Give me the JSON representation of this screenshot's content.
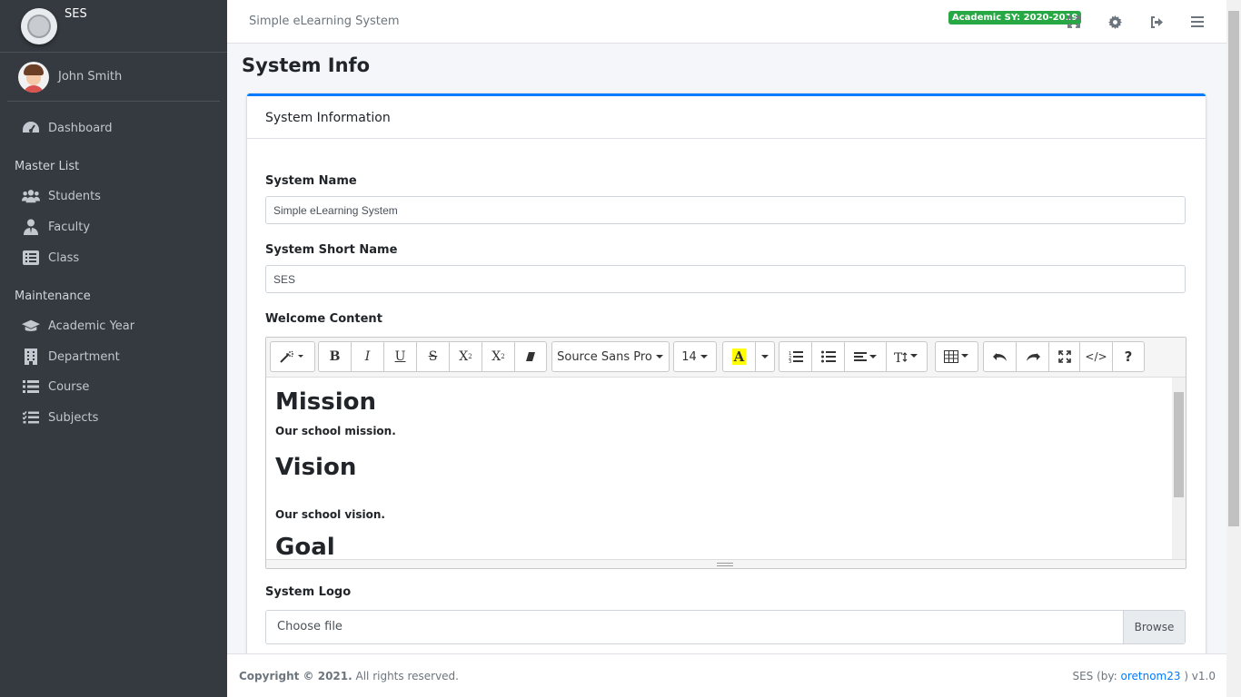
{
  "brand": {
    "name": "SES"
  },
  "user": {
    "name": "John Smith"
  },
  "sidebar": {
    "dashboard": "Dashboard",
    "master_header": "Master List",
    "master_items": [
      {
        "label": "Students",
        "icon": "users-icon"
      },
      {
        "label": "Faculty",
        "icon": "user-tie-icon"
      },
      {
        "label": "Class",
        "icon": "list-alt-icon"
      }
    ],
    "maintenance_header": "Maintenance",
    "maintenance_items": [
      {
        "label": "Academic Year",
        "icon": "graduation-cap-icon"
      },
      {
        "label": "Department",
        "icon": "building-icon"
      },
      {
        "label": "Course",
        "icon": "list-icon"
      },
      {
        "label": "Subjects",
        "icon": "tasks-icon"
      }
    ]
  },
  "topbar": {
    "title": "Simple eLearning System",
    "academic_badge": "Academic SY: 2020-2019"
  },
  "page": {
    "title": "System Info"
  },
  "card": {
    "header": "System Information"
  },
  "form": {
    "system_name_label": "System Name",
    "system_name_value": "Simple eLearning System",
    "short_name_label": "System Short Name",
    "short_name_value": "SES",
    "welcome_label": "Welcome Content",
    "logo_label": "System Logo",
    "file_placeholder": "Choose file",
    "browse_label": "Browse"
  },
  "editor": {
    "font_family": "Source Sans Pro",
    "font_size": "14",
    "content": [
      {
        "type": "h1",
        "text": "Mission"
      },
      {
        "type": "p",
        "text": "Our school mission."
      },
      {
        "type": "h1",
        "text": "Vision"
      },
      {
        "type": "p",
        "text": "Our school vision."
      },
      {
        "type": "h1",
        "text": "Goal"
      }
    ]
  },
  "footer": {
    "copyright": "Copyright © 2021.",
    "rights": " All rights reserved.",
    "credit_prefix": "SES (by: ",
    "credit_link": "oretnom23",
    "credit_suffix": " ) v1.0"
  },
  "colors": {
    "accent": "#007bff",
    "badge": "#28a745",
    "sidebar": "#343a40"
  }
}
